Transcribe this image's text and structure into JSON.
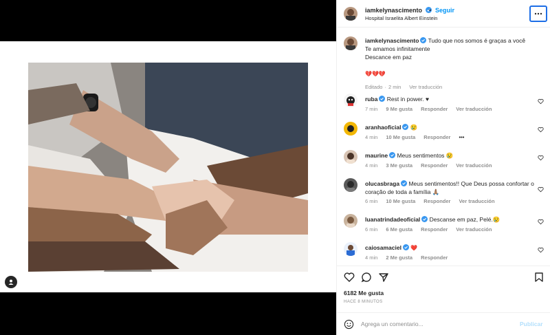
{
  "post": {
    "author": "iamkelynascimento",
    "follow_label": "Seguir",
    "separator": "•",
    "location": "Hospital Israelita Albert Einstein",
    "caption_line1": "Tudo que nos somos é graças a você",
    "caption_line2": "Te amamos infinitamente",
    "caption_line3": "Descance em paz",
    "caption_emoji": "💔💔💔",
    "caption_edited": "Editado",
    "caption_time": "2 min",
    "caption_translate": "Ver traducción"
  },
  "comments": [
    {
      "user": "ruba",
      "text": "Rest in power. ♥",
      "time": "7 min",
      "likes": "9 Me gusta",
      "reply": "Responder",
      "translate": "Ver traducción"
    },
    {
      "user": "aranhaoficial",
      "text": "😢",
      "time": "4 min",
      "likes": "10 Me gusta",
      "reply": "Responder",
      "translate": "•••"
    },
    {
      "user": "maurine",
      "text": "Meus sentimentos 😢",
      "time": "4 min",
      "likes": "3 Me gusta",
      "reply": "Responder",
      "translate": "Ver traducción"
    },
    {
      "user": "olucasbraga",
      "text": "Meus sentimentos!! Que Deus possa confortar o coração de toda a família 🙏🏽",
      "time": "6 min",
      "likes": "10 Me gusta",
      "reply": "Responder",
      "translate": "Ver traducción"
    },
    {
      "user": "luanatrindadeoficial",
      "text": "Descanse em paz, Pelé.😢",
      "time": "6 min",
      "likes": "6 Me gusta",
      "reply": "Responder",
      "translate": "Ver traducción"
    },
    {
      "user": "caiosamaciel",
      "text": "❤️",
      "time": "4 min",
      "likes": "2 Me gusta",
      "reply": "Responder",
      "translate": ""
    }
  ],
  "actions": {
    "like_count": "6182 Me gusta",
    "time_ago": "HACE 8 MINUTOS"
  },
  "comment_box": {
    "placeholder": "Agrega un comentario...",
    "publish_label": "Publicar"
  },
  "icons": [
    "verified-icon",
    "more-options-icon",
    "heart-icon",
    "comment-icon",
    "share-icon",
    "bookmark-icon",
    "emoji-icon",
    "user-tag-icon"
  ],
  "colors": {
    "accent": "#0095f6",
    "publish_disabled": "#b2dffc",
    "verified": "#3897f0",
    "focus_ring": "#1d6ee6"
  }
}
